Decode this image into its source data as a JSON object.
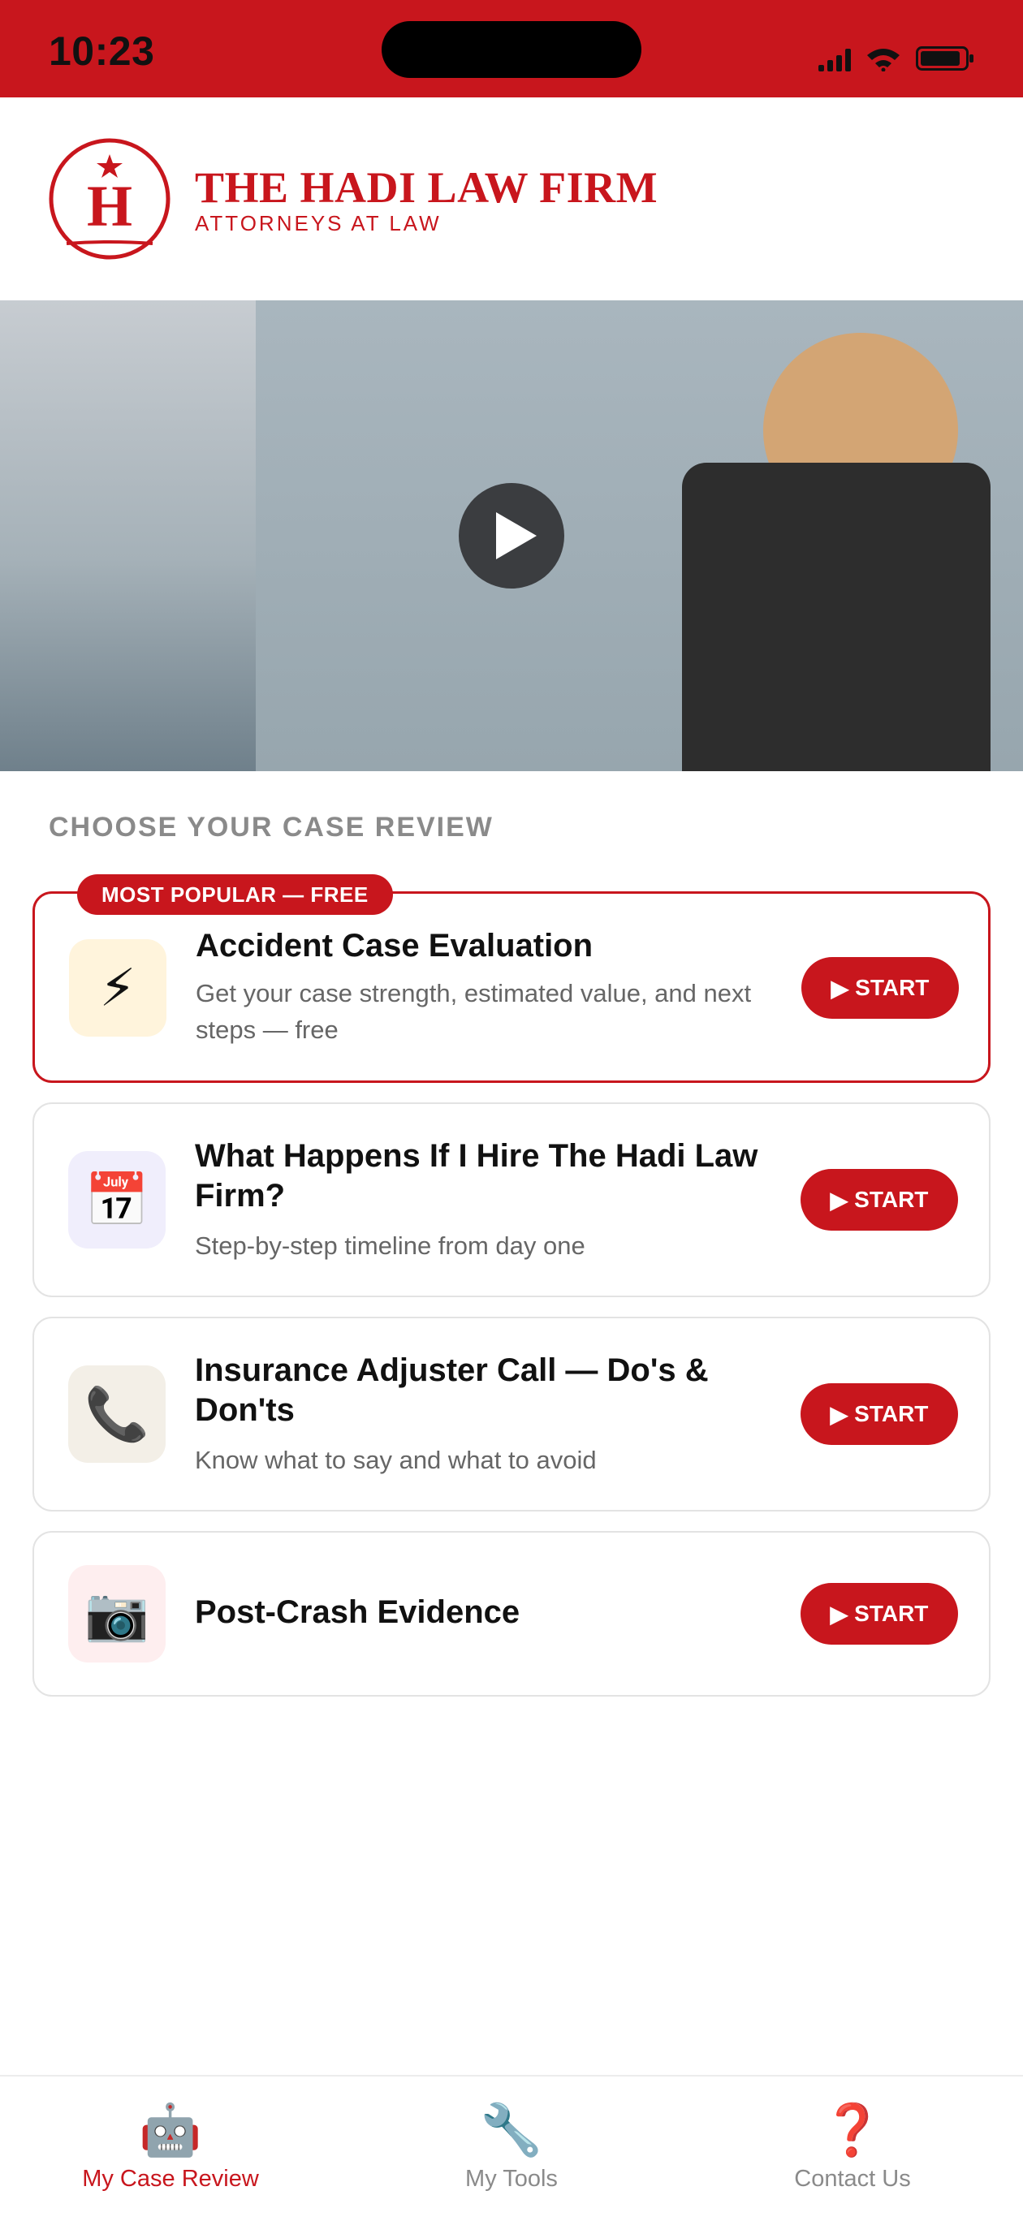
{
  "status_bar": {
    "time": "10:23"
  },
  "header": {
    "logo_letter": "H",
    "firm_name": "THE HADI LAW FIRM",
    "firm_subtitle": "ATTORNEYS AT LAW"
  },
  "video": {
    "play_icon": "play-icon"
  },
  "section": {
    "title": "CHOOSE YOUR CASE REVIEW"
  },
  "cards": [
    {
      "badge": "MOST POPULAR — FREE",
      "icon": "⚡",
      "icon_name": "lightning-icon",
      "title": "Accident Case Evaluation",
      "description": "Get your case strength, estimated value, and next steps — free",
      "button": "START"
    },
    {
      "icon": "📅",
      "icon_name": "calendar-icon",
      "title": "What Happens If I Hire The Hadi Law Firm?",
      "description": "Step-by-step timeline from day one",
      "button": "START"
    },
    {
      "icon": "📞",
      "icon_name": "phone-icon",
      "title": "Insurance Adjuster Call — Do's & Don'ts",
      "description": "Know what to say and what to avoid",
      "button": "START"
    },
    {
      "icon": "📷",
      "icon_name": "camera-icon",
      "title": "Post-Crash Evidence",
      "button": "START"
    }
  ],
  "bottom_nav": [
    {
      "icon": "🤖",
      "label": "My Case Review",
      "active": true
    },
    {
      "icon": "🔧",
      "label": "My Tools",
      "active": false
    },
    {
      "icon": "❓",
      "label": "Contact Us",
      "active": false
    }
  ],
  "colors": {
    "brand_red": "#c8161d",
    "muted_text": "#8a8a8a"
  }
}
